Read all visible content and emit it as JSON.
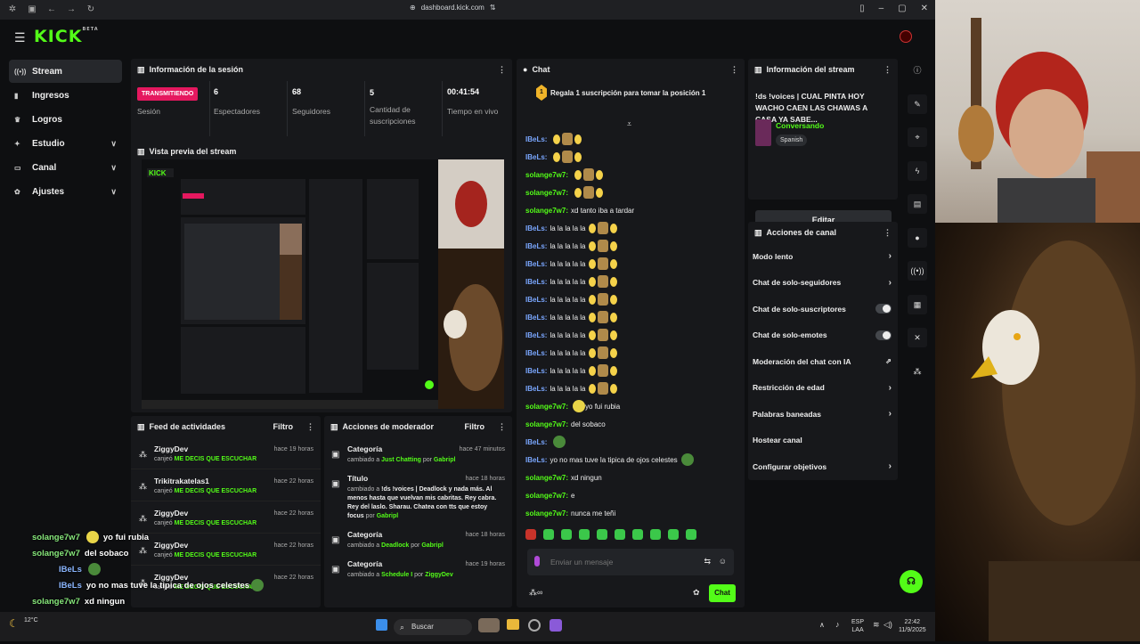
{
  "browser": {
    "url": "dashboard.kick.com"
  },
  "nav": {
    "logo": "KICK",
    "logo_sup": "BETA"
  },
  "sidebar": {
    "items": [
      {
        "label": "Stream",
        "icon": "stream-icon",
        "active": true
      },
      {
        "label": "Ingresos",
        "icon": "chart-icon"
      },
      {
        "label": "Logros",
        "icon": "trophy-icon"
      },
      {
        "label": "Estudio",
        "icon": "studio-icon",
        "expandable": true
      },
      {
        "label": "Canal",
        "icon": "channel-icon",
        "expandable": true
      },
      {
        "label": "Ajustes",
        "icon": "gear-icon",
        "expandable": true
      }
    ]
  },
  "session": {
    "title": "Información de la sesión",
    "status_badge": "TRANSMITIENDO",
    "stats": [
      {
        "value": "",
        "label": "Sesión"
      },
      {
        "value": "6",
        "label": "Espectadores"
      },
      {
        "value": "68",
        "label": "Seguidores"
      },
      {
        "value": "5",
        "label": "Cantidad de suscripciones"
      },
      {
        "value": "00:41:54",
        "label": "Tiempo en vivo"
      }
    ]
  },
  "preview": {
    "title": "Vista previa del stream"
  },
  "feed": {
    "title": "Feed de actividades",
    "filter": "Filtro",
    "items": [
      {
        "user": "ZiggyDev",
        "time": "hace 19 horas",
        "action": "canjeó",
        "reward": "ME DECIS QUE ESCUCHAR"
      },
      {
        "user": "Trikitrakatelas1",
        "time": "hace 22 horas",
        "action": "canjeó",
        "reward": "ME DECIS QUE ESCUCHAR"
      },
      {
        "user": "ZiggyDev",
        "time": "hace 22 horas",
        "action": "canjeó",
        "reward": "ME DECIS QUE ESCUCHAR"
      },
      {
        "user": "ZiggyDev",
        "time": "hace 22 horas",
        "action": "canjeó",
        "reward": "ME DECIS QUE ESCUCHAR"
      },
      {
        "user": "ZiggyDev",
        "time": "hace 22 horas",
        "action": "canjeó",
        "reward": "ME DECIS QUE ESCUCHAR"
      }
    ]
  },
  "modactions": {
    "title": "Acciones de moderador",
    "filter": "Filtro",
    "items": [
      {
        "type": "Categoría",
        "time": "hace 47 minutos",
        "pre": "cambiado a",
        "value": "Just Chatting",
        "mid": "por",
        "by": "Gabripl"
      },
      {
        "type": "Título",
        "time": "hace 18 horas",
        "pre": "cambiado a",
        "value": "!ds !voices | Deadlock y nada más. Al menos hasta que vuelvan mis cabritas. Rey cabra. Rey del laslo. Sharau. Chatea con tts que estoy focus",
        "mid": "por",
        "by": "Gabripl"
      },
      {
        "type": "Categoría",
        "time": "hace 18 horas",
        "pre": "cambiado a",
        "value": "Deadlock",
        "mid": "por",
        "by": "Gabripl"
      },
      {
        "type": "Categoría",
        "time": "hace 19 horas",
        "pre": "cambiado a",
        "value": "Schedule I",
        "mid": "por",
        "by": "ZiggyDev"
      }
    ]
  },
  "chat": {
    "title": "Chat",
    "pinned": "Regala 1 suscripción para tomar la posición 1",
    "pin_rank": "1",
    "messages": [
      {
        "user": "IBeLs:",
        "text": "",
        "color": "b",
        "emotes": [
          "y",
          "e",
          "y"
        ]
      },
      {
        "user": "IBeLs:",
        "text": "",
        "color": "b",
        "emotes": [
          "y",
          "e",
          "y"
        ]
      },
      {
        "user": "solange7w7:",
        "text": "",
        "color": "g",
        "emotes": [
          "y",
          "e",
          "y"
        ]
      },
      {
        "user": "solange7w7:",
        "text": "",
        "color": "g",
        "emotes": [
          "y",
          "e",
          "y"
        ]
      },
      {
        "user": "solange7w7:",
        "text": "xd tanto iba a tardar",
        "color": "g",
        "emotes": []
      },
      {
        "user": "IBeLs:",
        "text": "la la la la la",
        "color": "b",
        "emotes": [
          "y",
          "e",
          "y"
        ]
      },
      {
        "user": "IBeLs:",
        "text": "la la la la la",
        "color": "b",
        "emotes": [
          "y",
          "e",
          "y"
        ]
      },
      {
        "user": "IBeLs:",
        "text": "la la la la la",
        "color": "b",
        "emotes": [
          "y",
          "e",
          "y"
        ]
      },
      {
        "user": "IBeLs:",
        "text": "la la la la la",
        "color": "b",
        "emotes": [
          "y",
          "e",
          "y"
        ]
      },
      {
        "user": "IBeLs:",
        "text": "la la la la la",
        "color": "b",
        "emotes": [
          "y",
          "e",
          "y"
        ]
      },
      {
        "user": "IBeLs:",
        "text": "la la la la la",
        "color": "b",
        "emotes": [
          "y",
          "e",
          "y"
        ]
      },
      {
        "user": "IBeLs:",
        "text": "la la la la la",
        "color": "b",
        "emotes": [
          "y",
          "e",
          "y"
        ]
      },
      {
        "user": "IBeLs:",
        "text": "la la la la la",
        "color": "b",
        "emotes": [
          "y",
          "e",
          "y"
        ]
      },
      {
        "user": "IBeLs:",
        "text": "la la la la la",
        "color": "b",
        "emotes": [
          "y",
          "e",
          "y"
        ]
      },
      {
        "user": "IBeLs:",
        "text": "la la la la la",
        "color": "b",
        "emotes": [
          "y",
          "e",
          "y"
        ]
      },
      {
        "user": "solange7w7:",
        "text": "yo fui rubia",
        "color": "g",
        "emotes_before": [
          "f"
        ]
      },
      {
        "user": "solange7w7:",
        "text": "del sobaco",
        "color": "g",
        "emotes": []
      },
      {
        "user": "IBeLs:",
        "text": "",
        "color": "b",
        "emotes": [
          "p"
        ]
      },
      {
        "user": "IBeLs:",
        "text": "yo no mas tuve la tipica de ojos celestes",
        "color": "b",
        "emotes": [
          "p"
        ]
      },
      {
        "user": "solange7w7:",
        "text": "xd ningun",
        "color": "g",
        "emotes": []
      },
      {
        "user": "solange7w7:",
        "text": "e",
        "color": "g",
        "emotes": []
      },
      {
        "user": "solange7w7:",
        "text": "nunca me teñi",
        "color": "g",
        "emotes": []
      }
    ],
    "placeholder": "Enviar un mensaje",
    "send_label": "Chat"
  },
  "stream_info": {
    "title": "Información del stream",
    "stream_title": "!ds !voices | CUAL PINTA HOY WACHO CAEN LAS CHAWAS A CASA YA SABE...",
    "category": "Conversando",
    "language": "Spanish",
    "edit_label": "Editar"
  },
  "channel_actions": {
    "title": "Acciones de canal",
    "items": [
      {
        "label": "Modo lento",
        "control": "chevron"
      },
      {
        "label": "Chat de solo-seguidores",
        "control": "chevron"
      },
      {
        "label": "Chat de solo-suscriptores",
        "control": "toggle"
      },
      {
        "label": "Chat de solo-emotes",
        "control": "toggle"
      },
      {
        "label": "Moderación del chat con IA",
        "control": "external"
      },
      {
        "label": "Restricción de edad",
        "control": "chevron"
      },
      {
        "label": "Palabras baneadas",
        "control": "chevron"
      },
      {
        "label": "Hostear canal",
        "control": "none"
      },
      {
        "label": "Configurar objetivos",
        "control": "chevron"
      }
    ]
  },
  "overlay": {
    "lines": [
      {
        "user": "solange7w7",
        "text": "yo fui rubia",
        "color": "g"
      },
      {
        "user": "solange7w7",
        "text": "del sobaco",
        "color": "g"
      },
      {
        "user": "IBeLs",
        "text": "",
        "color": "b"
      },
      {
        "user": "IBeLs",
        "text": "yo no mas tuve la tipica de ojos celestes",
        "color": "b"
      },
      {
        "user": "solange7w7",
        "text": "xd ningun",
        "color": "g"
      },
      {
        "user": "solange7w7",
        "text": "e",
        "color": "g"
      },
      {
        "user": "solange7w7",
        "text": "nunca me teñi",
        "color": "g"
      }
    ]
  },
  "taskbar": {
    "search": "Buscar",
    "lang": "ESP",
    "lang2": "LAA",
    "time": "22:42",
    "date": "11/9/2025",
    "weather": "12°C"
  },
  "colors": {
    "accent": "#53fc18",
    "live": "#e5185f",
    "panel": "#17181b"
  }
}
